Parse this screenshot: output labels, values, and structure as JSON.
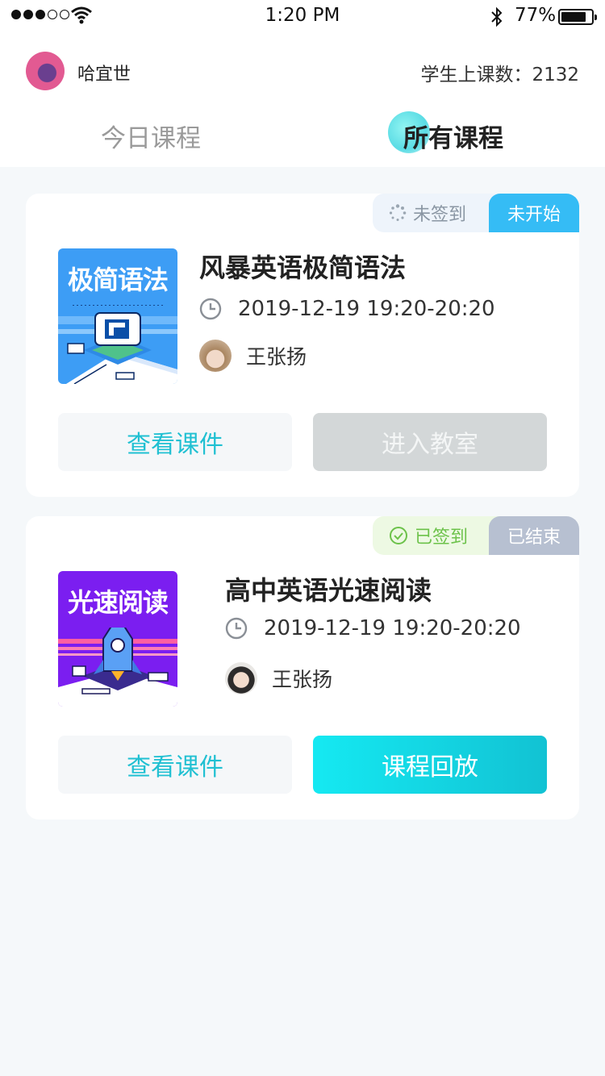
{
  "status_bar": {
    "time": "1:20 PM",
    "battery_percent": "77%",
    "battery_level": 0.77
  },
  "header": {
    "user_name": "哈宜世",
    "lesson_count_label": "学生上课数：",
    "lesson_count_value": "2132"
  },
  "tabs": [
    {
      "label": "今日课程",
      "active": false
    },
    {
      "label": "所有课程",
      "active": true
    }
  ],
  "courses": [
    {
      "cover_text": "极简语法",
      "title": "风暴英语极简语法",
      "time": "2019-12-19 19:20-20:20",
      "teacher": "王张扬",
      "checkin_status": "未签到",
      "class_status": "未开始",
      "buttons": {
        "courseware": "查看课件",
        "primary": "进入教室"
      }
    },
    {
      "cover_text": "光速阅读",
      "title": "高中英语光速阅读",
      "time": "2019-12-19 19:20-20:20",
      "teacher": "王张扬",
      "checkin_status": "已签到",
      "class_status": "已结束",
      "buttons": {
        "courseware": "查看课件",
        "primary": "课程回放"
      }
    }
  ],
  "colors": {
    "accent": "#20c0d2",
    "status_upcoming": "#35bcf5",
    "status_ended": "#b7c0d1",
    "checked_in": "#6cc24a"
  }
}
